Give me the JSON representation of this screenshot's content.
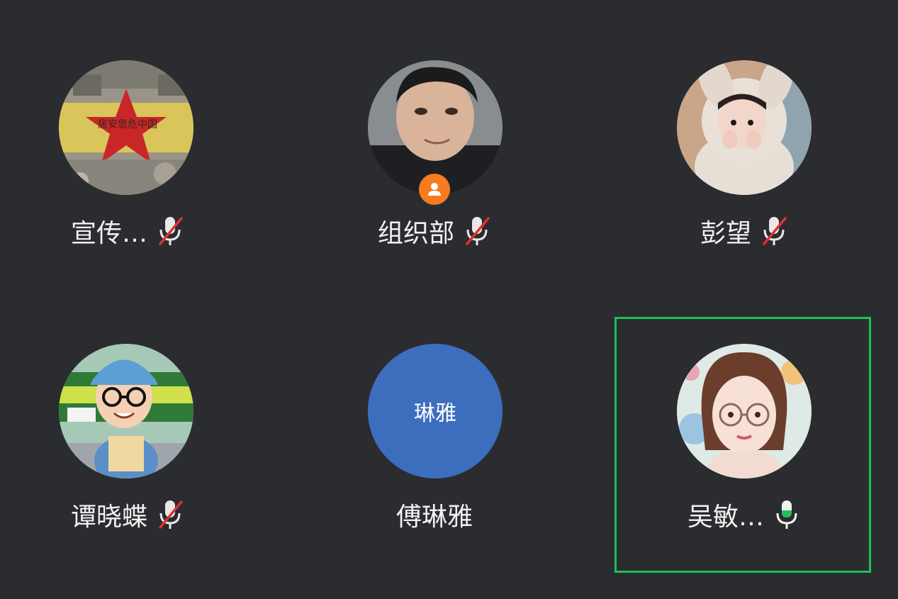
{
  "participants": [
    {
      "name": "宣传…",
      "mic": "muted",
      "avatar_icon": "red-star-wall-avatar"
    },
    {
      "name": "组织部",
      "mic": "muted",
      "avatar_icon": "young-man-photo-avatar",
      "badge_icon": "host-person-icon"
    },
    {
      "name": "彭望",
      "mic": "muted",
      "avatar_icon": "child-bunny-hood-avatar"
    },
    {
      "name": "谭晓蝶",
      "mic": "muted",
      "avatar_icon": "cartoon-man-cap-avatar"
    },
    {
      "name": "傅琳雅",
      "mic": "none",
      "initials": "琳雅"
    },
    {
      "name": "吴敏…",
      "mic": "speaking",
      "avatar_icon": "illustrated-woman-glasses-avatar"
    }
  ],
  "colors": {
    "background": "#2b2c30",
    "speaking_border": "#1fbf5a",
    "muted_slash": "#e0302f",
    "host_badge": "#f57c1f",
    "initials_avatar": "#3d6ebd",
    "mic_level": "#1fbf5a"
  }
}
